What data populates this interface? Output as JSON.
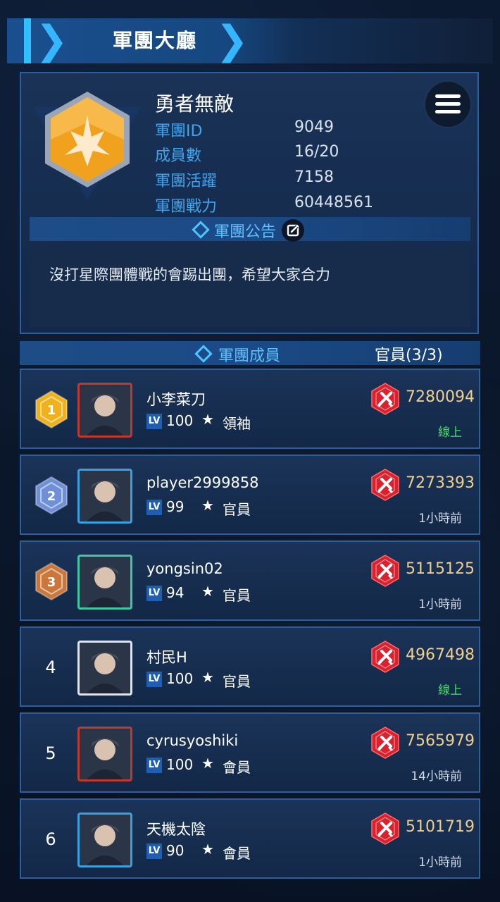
{
  "header": {
    "title": "軍團大廳"
  },
  "guild": {
    "name": "勇者無敵",
    "id_label": "軍團ID",
    "id_value": "9049",
    "members_label": "成員數",
    "members_value": "16/20",
    "activity_label": "軍團活躍",
    "activity_value": "7158",
    "power_label": "軍團戰力",
    "power_value": "60448561",
    "menu_icon": "list-menu-icon"
  },
  "announcement": {
    "heading": "軍團公告",
    "text": "沒打星際團體戰的會踢出團，希望大家合力",
    "edit_icon": "edit-icon"
  },
  "members_section": {
    "heading": "軍團成員",
    "officers": "官員(3/3)"
  },
  "members": [
    {
      "rank": "1",
      "name": "小李菜刀",
      "lv_tag": "LV",
      "level": "100",
      "role": "領袖",
      "power": "7280094",
      "status": "線上",
      "online": true,
      "badge_color": "#f0b21c",
      "frame_color": "#c0392b"
    },
    {
      "rank": "2",
      "name": "player2999858",
      "lv_tag": "LV",
      "level": "99",
      "role": "官員",
      "power": "7273393",
      "status": "1小時前",
      "online": false,
      "badge_color": "#6f8fd6",
      "frame_color": "#3aa0e0"
    },
    {
      "rank": "3",
      "name": "yongsin02",
      "lv_tag": "LV",
      "level": "94",
      "role": "官員",
      "power": "5115125",
      "status": "1小時前",
      "online": false,
      "badge_color": "#c9773a",
      "frame_color": "#3fc9a0"
    },
    {
      "rank": "4",
      "name": "村民H",
      "lv_tag": "LV",
      "level": "100",
      "role": "官員",
      "power": "4967498",
      "status": "線上",
      "online": true,
      "badge_color": "",
      "frame_color": "#e0e4ea"
    },
    {
      "rank": "5",
      "name": "cyrusyoshiki",
      "lv_tag": "LV",
      "level": "100",
      "role": "會員",
      "power": "7565979",
      "status": "14小時前",
      "online": false,
      "badge_color": "",
      "frame_color": "#c0392b"
    },
    {
      "rank": "6",
      "name": "天機太陰",
      "lv_tag": "LV",
      "level": "90",
      "role": "會員",
      "power": "5101719",
      "status": "1小時前",
      "online": false,
      "badge_color": "",
      "frame_color": "#3aa0e0"
    }
  ],
  "colors": {
    "accent": "#3fa5ef",
    "power_text": "#f0cf8c",
    "online": "#3fe35a",
    "power_badge": "#d9222e"
  }
}
